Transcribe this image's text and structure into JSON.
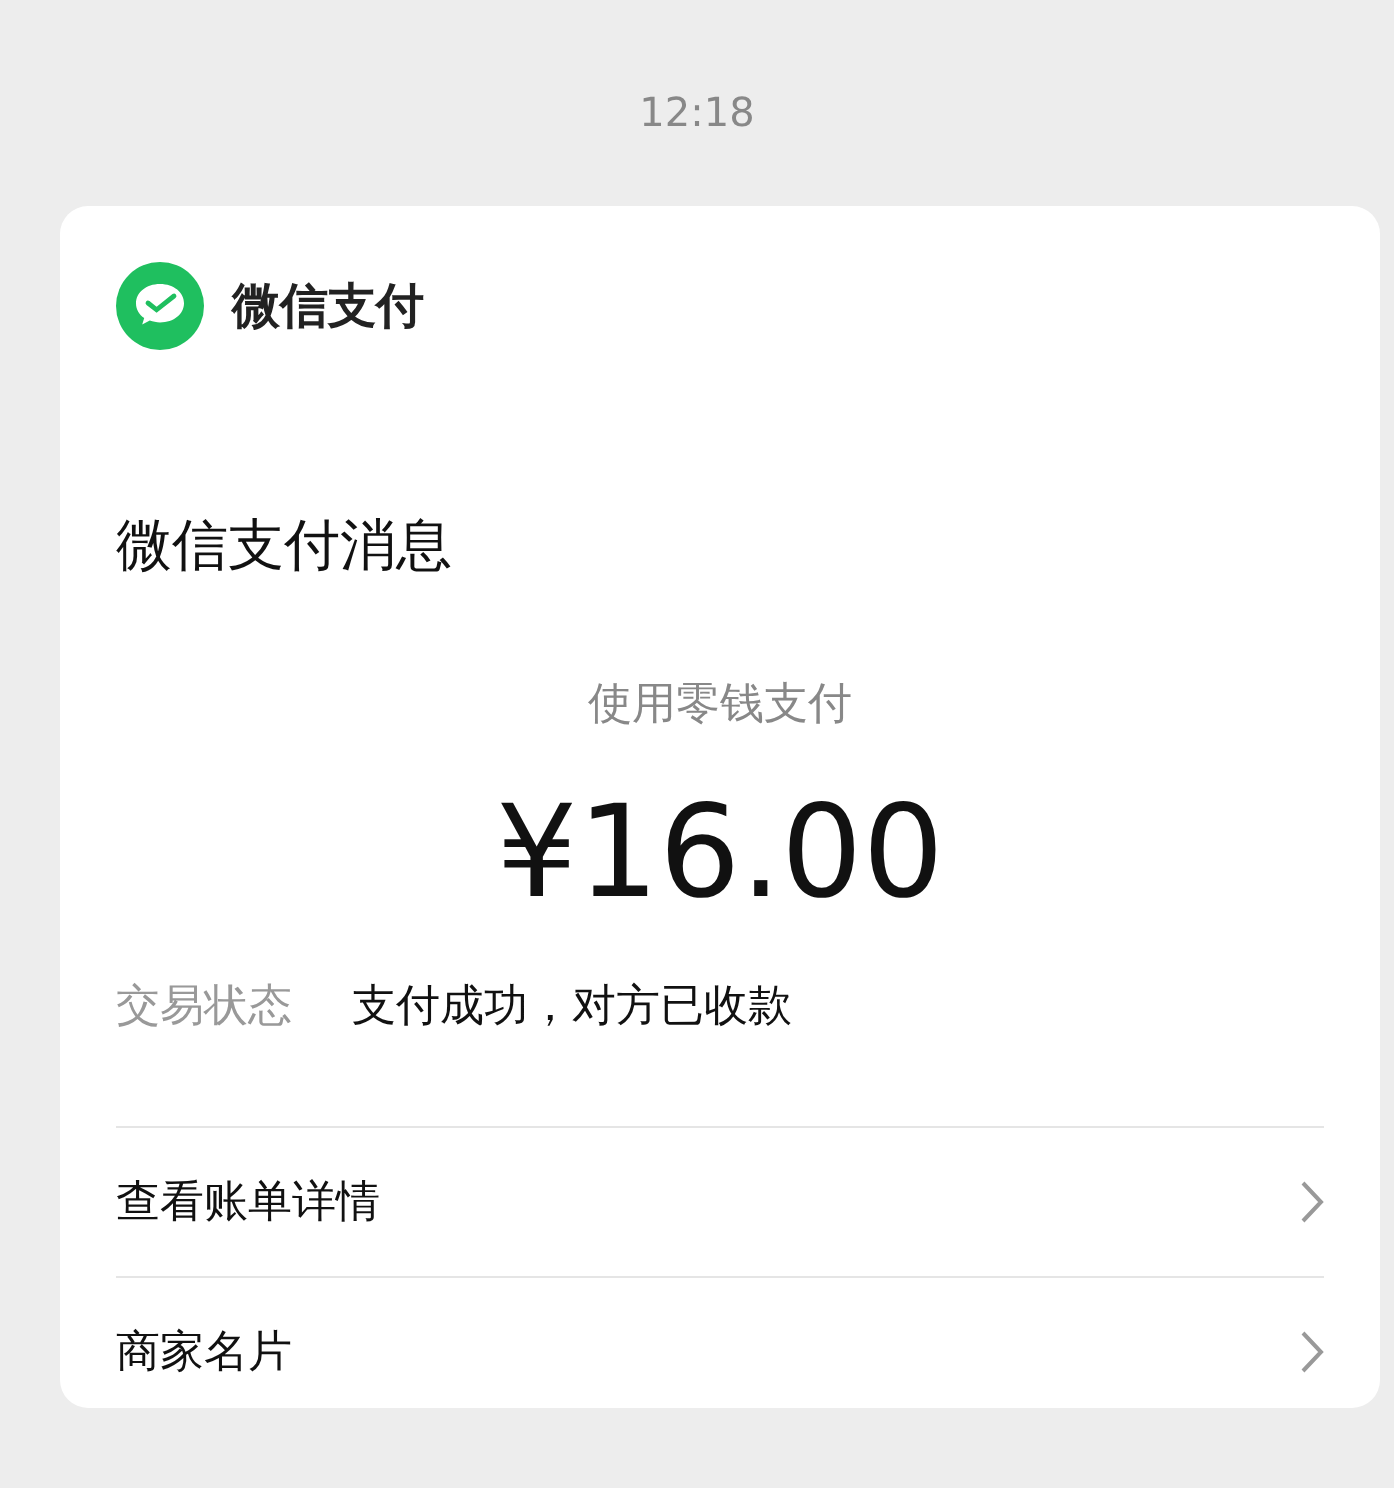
{
  "time": "12:18",
  "card": {
    "brand": "微信支付",
    "title": "微信支付消息",
    "subtitle": "使用零钱支付",
    "amount": "¥16.00",
    "fields": [
      {
        "label": "交易状态",
        "value": "支付成功，对方已收款"
      }
    ],
    "links": [
      {
        "label": "查看账单详情"
      },
      {
        "label": "商家名片"
      }
    ]
  }
}
